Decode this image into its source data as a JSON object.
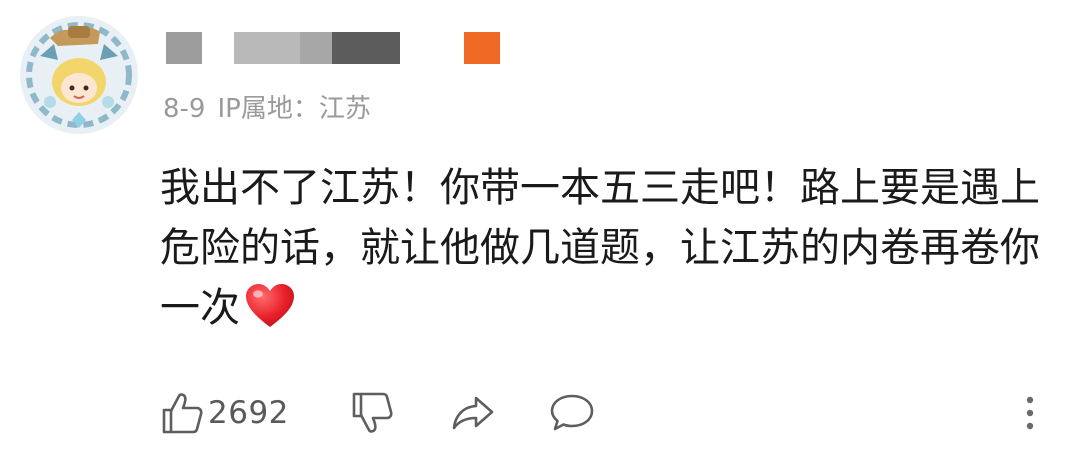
{
  "comment": {
    "avatar": {
      "icon": "anime-character-avatar-icon"
    },
    "username": {
      "redacted": true
    },
    "badge": {
      "color": "#ef6a24"
    },
    "date": "8-9",
    "ip_location": "IP属地：江苏",
    "text": "我出不了江苏！你带一本五三走吧！路上要是遇上危险的话，就让他做几道题，让江苏的内卷再卷你一次",
    "emoji": "red-heart-icon",
    "actions": {
      "like_count": "2692",
      "like_icon": "thumbs-up-icon",
      "dislike_icon": "thumbs-down-icon",
      "share_icon": "share-arrow-icon",
      "reply_icon": "speech-bubble-icon",
      "more_icon": "more-vertical-icon"
    }
  }
}
